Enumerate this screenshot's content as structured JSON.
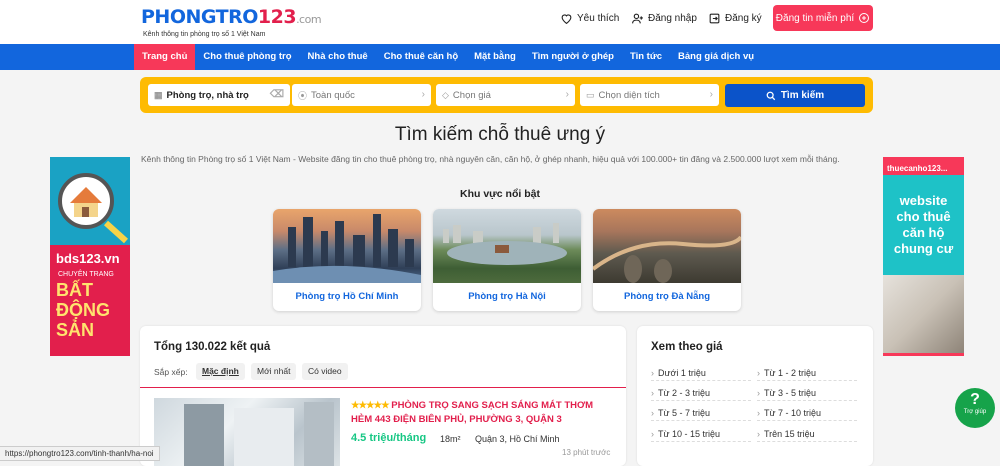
{
  "logo": {
    "brand_main": "PHONGTRO",
    "brand_num": "123",
    "brand_tld": ".com",
    "tagline": "Kênh thông tin phòng trọ số 1 Việt Nam"
  },
  "header": {
    "favorites": "Yêu thích",
    "login": "Đăng nhập",
    "register": "Đăng ký",
    "post_button": "Đăng tin miễn phí"
  },
  "nav": {
    "items": [
      "Trang chủ",
      "Cho thuê phòng trọ",
      "Nhà cho thuê",
      "Cho thuê căn hộ",
      "Mặt bằng",
      "Tìm người ở ghép",
      "Tin tức",
      "Bảng giá dịch vụ"
    ],
    "active": "Trang chủ"
  },
  "search": {
    "type": "Phòng trọ, nhà trọ",
    "location": "Toàn quốc",
    "price": "Chọn giá",
    "area": "Chọn diện tích",
    "button": "Tìm kiếm"
  },
  "hero": {
    "title": "Tìm kiếm chỗ thuê ưng ý",
    "description": "Kênh thông tin Phòng trọ số 1 Việt Nam - Website đăng tin cho thuê phòng trọ, nhà nguyên căn, căn hộ, ở ghép nhanh, hiệu quả với 100.000+ tin đăng và 2.500.000 lượt xem mỗi tháng."
  },
  "featured": {
    "heading": "Khu vực nổi bật",
    "cities": [
      {
        "label": "Phòng trọ Hồ Chí Minh"
      },
      {
        "label": "Phòng trọ Hà Nội"
      },
      {
        "label": "Phòng trọ Đà Nẵng"
      }
    ]
  },
  "ad_left": {
    "brand": "bds123.vn",
    "line1": "CHUYÊN TRANG",
    "line2": "BẤT",
    "line3": "ĐỘNG",
    "line4": "SẢN"
  },
  "ad_right": {
    "brand": "thuecanho123...",
    "text": "website cho thuê căn hộ chung cư"
  },
  "results": {
    "total": "Tổng 130.022 kết quả",
    "sort_label": "Sắp xếp:",
    "sort_options": [
      "Mặc định",
      "Mới nhất",
      "Có video"
    ],
    "sort_active": "Mặc định",
    "listing": {
      "stars": "★★★★★",
      "title": "PHÒNG TRỌ SANG SẠCH SÁNG MÁT THƠM HẺM 443 ĐIỆN BIÊN PHỦ, PHƯỜNG 3, QUẬN 3",
      "price": "4.5 triệu/tháng",
      "area": "18m²",
      "location": "Quận 3, Hồ Chí Minh",
      "time": "13 phút trước"
    }
  },
  "price_filter": {
    "heading": "Xem theo giá",
    "options": [
      "Dưới 1 triệu",
      "Từ 1 - 2 triệu",
      "Từ 2 - 3 triệu",
      "Từ 3 - 5 triệu",
      "Từ 5 - 7 triệu",
      "Từ 7 - 10 triệu",
      "Từ 10 - 15 triệu",
      "Trên 15 triệu"
    ]
  },
  "help": {
    "label": "Trợ giúp"
  },
  "status_url": "https://phongtro123.com/tinh-thanh/ha-noi",
  "colors": {
    "primary": "#1266dd",
    "accent": "#f73859",
    "search_bg": "#febb02",
    "price": "#16c784"
  }
}
